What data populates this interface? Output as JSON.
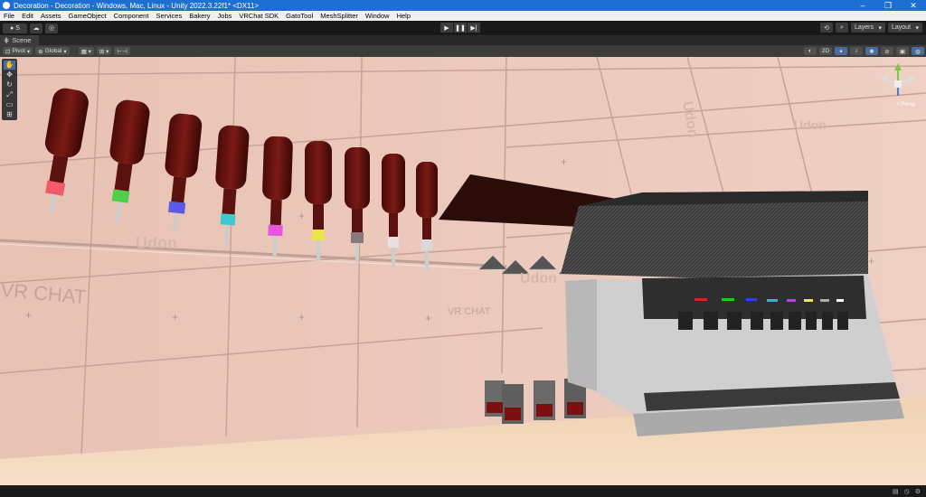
{
  "window": {
    "title": "Decoration - Decoration - Windows, Mac, Linux - Unity 2022.3.22f1* <DX11>",
    "controls": [
      "–",
      "❐",
      "✕"
    ]
  },
  "menu": [
    "File",
    "Edit",
    "Assets",
    "GameObject",
    "Component",
    "Services",
    "Bakery",
    "Jobs",
    "VRChat SDK",
    "GatoTool",
    "MeshSplitter",
    "Window",
    "Help"
  ],
  "toolbar": {
    "account_label": "S",
    "play_icons": [
      "play-icon",
      "pause-icon",
      "step-icon"
    ],
    "layers_label": "Layers",
    "layout_label": "Layout"
  },
  "scene_tab": {
    "label": "Scene"
  },
  "scene_toolbar": {
    "pivot_label": "Pivot",
    "global_label": "Global",
    "mode_2d_label": "2D"
  },
  "tools": [
    "hand-icon",
    "move-icon",
    "rotate-icon",
    "scale-icon",
    "rect-icon",
    "transform-icon"
  ],
  "gizmo": {
    "label": "< Persp"
  },
  "scene": {
    "wall_text_1": "VR CHAT",
    "wall_text_2": "VR CHAT",
    "logo_text": "Udon",
    "bottle_label_colors": [
      "#f05a6a",
      "#4fcf4a",
      "#5a5ae6",
      "#3fc8d0",
      "#e455e0",
      "#e8e44a",
      "#8a7878",
      "#e8e0e0",
      "#d8d8d8"
    ],
    "dispenser_light_colors": [
      "#e02020",
      "#22cc22",
      "#2244ee",
      "#22bbcc",
      "#dd33dd",
      "#eeee22",
      "#aaaaaa",
      "#ffffff"
    ]
  },
  "statusbar": {
    "icons": [
      "console-icon",
      "progress-icon",
      "settings-icon"
    ]
  }
}
